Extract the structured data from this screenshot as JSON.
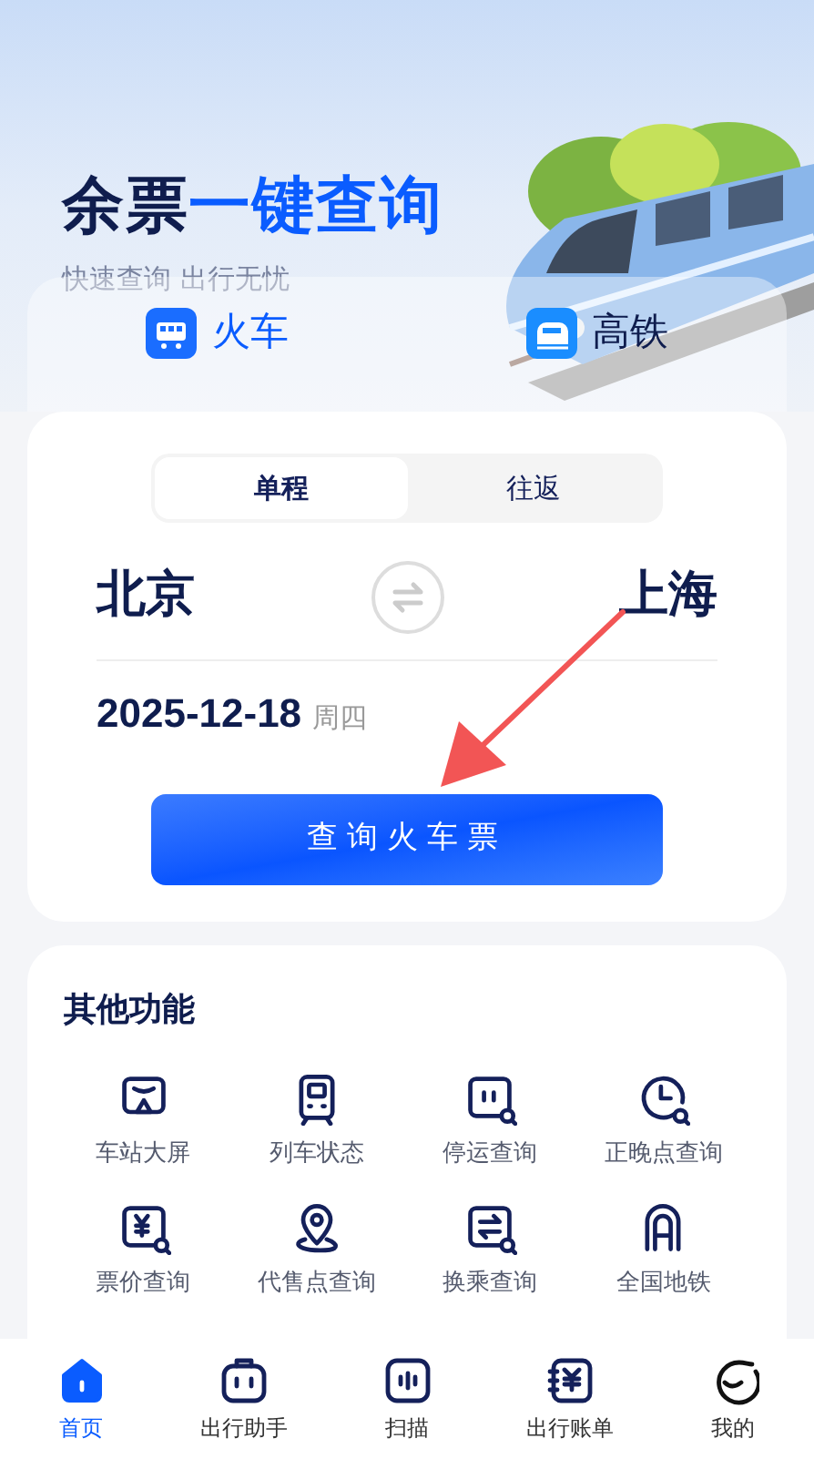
{
  "header": {
    "title_dark": "余票",
    "title_accent": "一键查询",
    "subtitle": "快速查询 出行无忧"
  },
  "transport_tabs": [
    {
      "label": "火车",
      "selected": true,
      "kind": "train"
    },
    {
      "label": "高铁",
      "selected": false,
      "kind": "bullet"
    }
  ],
  "trip_types": [
    {
      "label": "单程",
      "selected": true
    },
    {
      "label": "往返",
      "selected": false
    }
  ],
  "from": "北京",
  "to": "上海",
  "date": "2025-12-18",
  "weekday": "周四",
  "search_button": "查询火车票",
  "functions": {
    "title": "其他功能",
    "items": [
      {
        "label": "车站大屏",
        "kind": "screen"
      },
      {
        "label": "列车状态",
        "kind": "train"
      },
      {
        "label": "停运查询",
        "kind": "stop"
      },
      {
        "label": "正晚点查询",
        "kind": "clock"
      },
      {
        "label": "票价查询",
        "kind": "price"
      },
      {
        "label": "代售点查询",
        "kind": "pin"
      },
      {
        "label": "换乘查询",
        "kind": "transfer"
      },
      {
        "label": "全国地铁",
        "kind": "metro"
      }
    ]
  },
  "nav": [
    {
      "label": "首页",
      "selected": true,
      "kind": "home"
    },
    {
      "label": "出行助手",
      "selected": false,
      "kind": "assistant"
    },
    {
      "label": "扫描",
      "selected": false,
      "kind": "scan"
    },
    {
      "label": "出行账单",
      "selected": false,
      "kind": "bill"
    },
    {
      "label": "我的",
      "selected": false,
      "kind": "me"
    }
  ]
}
